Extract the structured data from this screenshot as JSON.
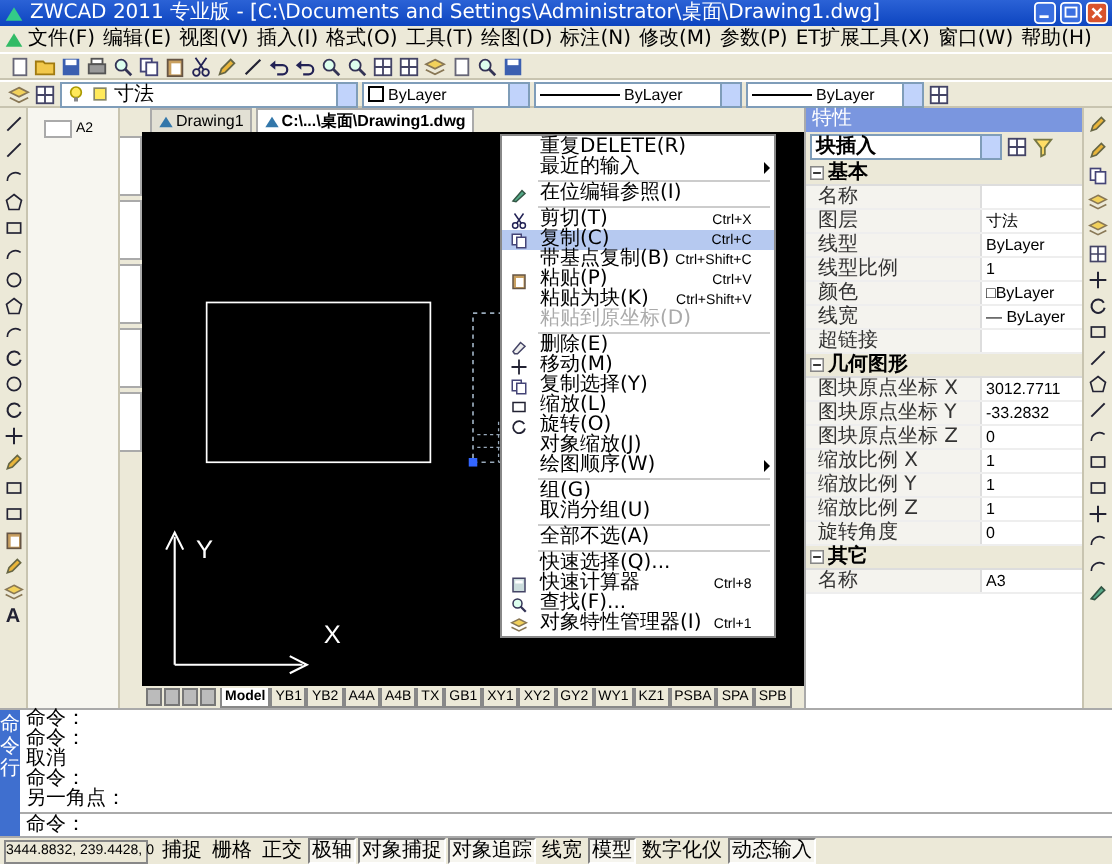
{
  "window": {
    "title": "ZWCAD 2011 专业版 - [C:\\Documents and Settings\\Administrator\\桌面\\Drawing1.dwg]"
  },
  "menu_bar": [
    "文件(F)",
    "编辑(E)",
    "视图(V)",
    "插入(I)",
    "格式(O)",
    "工具(T)",
    "绘图(D)",
    "标注(N)",
    "修改(M)",
    "参数(P)",
    "ET扩展工具(X)",
    "窗口(W)",
    "帮助(H)"
  ],
  "layer_toolbar": {
    "layer": "寸法",
    "color_control": "ByLayer",
    "linetype": "ByLayer",
    "lineweight": "ByLayer"
  },
  "left_toolbar": {
    "text_tool": "A"
  },
  "left_panel": {
    "label": "A2"
  },
  "document_tabs": [
    {
      "label": "Drawing1",
      "selected": false
    },
    {
      "label": "C:\\...\\桌面\\Drawing1.dwg",
      "selected": true
    }
  ],
  "canvas": {
    "axis_x": "X",
    "axis_y": "Y"
  },
  "layout_tabs": [
    {
      "label": "Model",
      "selected": true
    },
    {
      "label": "YB1",
      "selected": false
    },
    {
      "label": "YB2",
      "selected": false
    },
    {
      "label": "A4A",
      "selected": false
    },
    {
      "label": "A4B",
      "selected": false
    },
    {
      "label": "TX",
      "selected": false
    },
    {
      "label": "GB1",
      "selected": false
    },
    {
      "label": "XY1",
      "selected": false
    },
    {
      "label": "XY2",
      "selected": false
    },
    {
      "label": "GY2",
      "selected": false
    },
    {
      "label": "WY1",
      "selected": false
    },
    {
      "label": "KZ1",
      "selected": false
    },
    {
      "label": "PSBA",
      "selected": false
    },
    {
      "label": "SPA",
      "selected": false
    },
    {
      "label": "SPB",
      "selected": false
    }
  ],
  "properties": {
    "title": "特性",
    "object": "块插入",
    "groups": [
      {
        "name": "基本",
        "expanded": true,
        "rows": [
          {
            "label": "名称"
          },
          {
            "label": "图层",
            "value": "寸法"
          },
          {
            "label": "线型",
            "value": "ByLayer"
          },
          {
            "label": "线型比例",
            "value": "1"
          },
          {
            "label": "颜色",
            "value": "□ByLayer"
          },
          {
            "label": "线宽",
            "value": "— ByLayer"
          },
          {
            "label": "超链接"
          }
        ]
      },
      {
        "name": "几何图形",
        "expanded": true,
        "rows": [
          {
            "label": "图块原点坐标 X",
            "value": "3012.7711"
          },
          {
            "label": "图块原点坐标 Y",
            "value": "-33.2832"
          },
          {
            "label": "图块原点坐标 Z",
            "value": "0"
          },
          {
            "label": "缩放比例 X",
            "value": "1"
          },
          {
            "label": "缩放比例 Y",
            "value": "1"
          },
          {
            "label": "缩放比例 Z",
            "value": "1"
          },
          {
            "label": "旋转角度",
            "value": "0"
          }
        ]
      },
      {
        "name": "其它",
        "expanded": true,
        "rows": [
          {
            "label": "名称",
            "value": "A3"
          }
        ]
      }
    ]
  },
  "context_menu": [
    {
      "kind": "item",
      "label": "重复DELETE(R)",
      "submenu": false,
      "disabled": false,
      "selected": false
    },
    {
      "kind": "item",
      "label": "最近的输入",
      "submenu": true,
      "disabled": false,
      "selected": false
    },
    {
      "kind": "separator"
    },
    {
      "kind": "item",
      "label": "在位编辑参照(I)",
      "submenu": false,
      "disabled": false,
      "selected": false
    },
    {
      "kind": "separator"
    },
    {
      "kind": "item",
      "label": "剪切(T)",
      "shortcut": "Ctrl+X",
      "submenu": false,
      "disabled": false,
      "selected": false
    },
    {
      "kind": "item",
      "label": "复制(C)",
      "shortcut": "Ctrl+C",
      "submenu": false,
      "disabled": false,
      "selected": true
    },
    {
      "kind": "item",
      "label": "带基点复制(B)",
      "shortcut": "Ctrl+Shift+C",
      "submenu": false,
      "disabled": false,
      "selected": false
    },
    {
      "kind": "item",
      "label": "粘贴(P)",
      "shortcut": "Ctrl+V",
      "submenu": false,
      "disabled": false,
      "selected": false
    },
    {
      "kind": "item",
      "label": "粘贴为块(K)",
      "shortcut": "Ctrl+Shift+V",
      "submenu": false,
      "disabled": false,
      "selected": false
    },
    {
      "kind": "item",
      "label": "粘贴到原坐标(D)",
      "submenu": false,
      "disabled": true,
      "selected": false
    },
    {
      "kind": "separator"
    },
    {
      "kind": "item",
      "label": "删除(E)",
      "submenu": false,
      "disabled": false,
      "selected": false
    },
    {
      "kind": "item",
      "label": "移动(M)",
      "submenu": false,
      "disabled": false,
      "selected": false
    },
    {
      "kind": "item",
      "label": "复制选择(Y)",
      "submenu": false,
      "disabled": false,
      "selected": false
    },
    {
      "kind": "item",
      "label": "缩放(L)",
      "submenu": false,
      "disabled": false,
      "selected": false
    },
    {
      "kind": "item",
      "label": "旋转(O)",
      "submenu": false,
      "disabled": false,
      "selected": false
    },
    {
      "kind": "item",
      "label": "对象缩放(J)",
      "submenu": false,
      "disabled": false,
      "selected": false
    },
    {
      "kind": "item",
      "label": "绘图顺序(W)",
      "submenu": true,
      "disabled": false,
      "selected": false
    },
    {
      "kind": "separator"
    },
    {
      "kind": "item",
      "label": "组(G)",
      "submenu": false,
      "disabled": false,
      "selected": false
    },
    {
      "kind": "item",
      "label": "取消分组(U)",
      "submenu": false,
      "disabled": false,
      "selected": false
    },
    {
      "kind": "separator"
    },
    {
      "kind": "item",
      "label": "全部不选(A)",
      "submenu": false,
      "disabled": false,
      "selected": false
    },
    {
      "kind": "separator"
    },
    {
      "kind": "item",
      "label": "快速选择(Q)...",
      "submenu": false,
      "disabled": false,
      "selected": false
    },
    {
      "kind": "item",
      "label": "快速计算器",
      "shortcut": "Ctrl+8",
      "submenu": false,
      "disabled": false,
      "selected": false
    },
    {
      "kind": "item",
      "label": "查找(F)...",
      "submenu": false,
      "disabled": false,
      "selected": false
    },
    {
      "kind": "item",
      "label": "对象特性管理器(I)",
      "shortcut": "Ctrl+1",
      "submenu": false,
      "disabled": false,
      "selected": false
    }
  ],
  "command_line": {
    "label": "命令行",
    "history": [
      "命令：",
      "命令：",
      "取消",
      "命令：",
      "另一角点："
    ],
    "prompt": "命令："
  },
  "status_bar": {
    "coordinates": "3444.8832, 239.4428, 0",
    "toggles": [
      {
        "label": "捕捉",
        "on": false
      },
      {
        "label": "栅格",
        "on": false
      },
      {
        "label": "正交",
        "on": false
      },
      {
        "label": "极轴",
        "on": true
      },
      {
        "label": "对象捕捉",
        "on": true
      },
      {
        "label": "对象追踪",
        "on": true
      },
      {
        "label": "线宽",
        "on": false
      },
      {
        "label": "模型",
        "on": true
      },
      {
        "label": "数字化仪",
        "on": false
      },
      {
        "label": "动态输入",
        "on": true
      }
    ]
  }
}
